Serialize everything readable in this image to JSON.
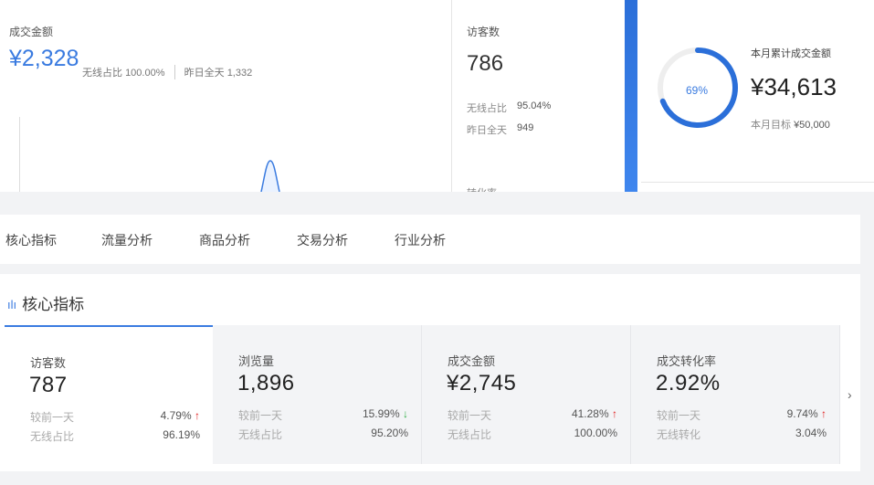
{
  "sales": {
    "label": "成交金额",
    "amount": "¥2,328",
    "wireless_label": "无线占比",
    "wireless_value": "100.00%",
    "yesterday_label": "昨日全天",
    "yesterday_value": "1,332"
  },
  "visitors": {
    "label": "访客数",
    "value": "786",
    "wireless_label": "无线占比",
    "wireless_value": "95.04%",
    "yesterday_label": "昨日全天",
    "yesterday_value": "949",
    "next_label_partial": "转化率"
  },
  "monthly": {
    "percent_text": "69%",
    "percent": 0.69,
    "label": "本月累计成交金额",
    "amount": "¥34,613",
    "target_label": "本月目标",
    "target_value": "¥50,000",
    "accent_color": "#2b6fd9"
  },
  "tabs": [
    "核心指标",
    "流量分析",
    "商品分析",
    "交易分析",
    "行业分析"
  ],
  "panel": {
    "title": "核心指标",
    "title_icon": "bar-chart-icon",
    "cards": [
      {
        "label": "访客数",
        "value": "787",
        "compare_label": "较前一天",
        "compare_value": "4.79%",
        "trend": "up",
        "sub_label": "无线占比",
        "sub_value": "96.19%"
      },
      {
        "label": "浏览量",
        "value": "1,896",
        "compare_label": "较前一天",
        "compare_value": "15.99%",
        "trend": "down",
        "sub_label": "无线占比",
        "sub_value": "95.20%"
      },
      {
        "label": "成交金额",
        "value": "¥2,745",
        "compare_label": "较前一天",
        "compare_value": "41.28%",
        "trend": "up",
        "sub_label": "无线占比",
        "sub_value": "100.00%"
      },
      {
        "label": "成交转化率",
        "value": "2.92%",
        "compare_label": "较前一天",
        "compare_value": "9.74%",
        "trend": "up",
        "sub_label": "无线转化",
        "sub_value": "3.04%"
      }
    ],
    "up_arrow": "↑",
    "down_arrow": "↓",
    "next_arrow": "›"
  },
  "colors": {
    "accent": "#3a7be0",
    "up": "#e02020",
    "down": "#2eae45"
  }
}
